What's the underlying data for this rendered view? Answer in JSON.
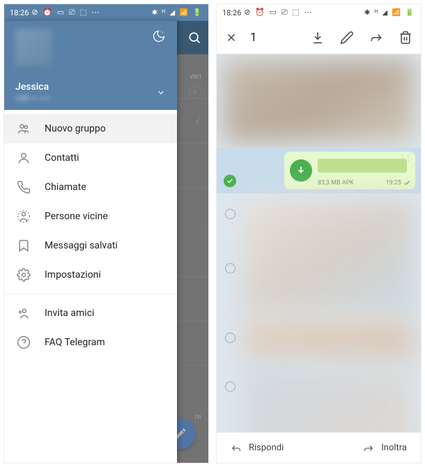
{
  "status": {
    "time": "18:26"
  },
  "drawer": {
    "username": "Jessica",
    "menu": [
      {
        "label": "Nuovo gruppo"
      },
      {
        "label": "Contatti"
      },
      {
        "label": "Chiamate"
      },
      {
        "label": "Persone vicine"
      },
      {
        "label": "Messaggi salvati"
      },
      {
        "label": "Impostazioni"
      },
      {
        "label": "Invita amici"
      },
      {
        "label": "FAQ Telegram"
      }
    ]
  },
  "behind": {
    "day_label": "ven",
    "partial_text": "re"
  },
  "selection": {
    "count": "1",
    "file": {
      "size": "83,3 MB APK",
      "time": "19:25"
    }
  },
  "bottom": {
    "reply": "Rispondi",
    "forward": "Inoltra"
  }
}
